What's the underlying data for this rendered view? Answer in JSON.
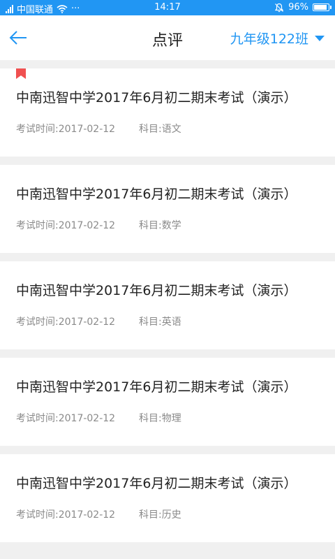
{
  "status_bar": {
    "carrier": "中国联通",
    "dots": "···",
    "time": "14:17",
    "battery_text": "96%",
    "battery_level": 0.96,
    "background": "#2196f3"
  },
  "header": {
    "title": "点评",
    "class_selector": "九年级122班",
    "accent_color": "#2196f3"
  },
  "exams": [
    {
      "title": "中南迅智中学2017年6月初二期末考试（演示）",
      "date": "考试时间:2017-02-12",
      "subject": "科目:语文",
      "bookmarked": true
    },
    {
      "title": "中南迅智中学2017年6月初二期末考试（演示）",
      "date": "考试时间:2017-02-12",
      "subject": "科目:数学",
      "bookmarked": false
    },
    {
      "title": "中南迅智中学2017年6月初二期末考试（演示）",
      "date": "考试时间:2017-02-12",
      "subject": "科目:英语",
      "bookmarked": false
    },
    {
      "title": "中南迅智中学2017年6月初二期末考试（演示）",
      "date": "考试时间:2017-02-12",
      "subject": "科目:物理",
      "bookmarked": false
    },
    {
      "title": "中南迅智中学2017年6月初二期末考试（演示）",
      "date": "考试时间:2017-02-12",
      "subject": "科目:历史",
      "bookmarked": false
    }
  ],
  "icons": {
    "back": "arrow-left-icon",
    "dropdown": "triangle-down-icon",
    "bookmark": "bookmark-icon",
    "signal": "signal-icon",
    "wifi": "wifi-icon",
    "mute": "bell-muted-icon",
    "battery": "battery-icon"
  }
}
